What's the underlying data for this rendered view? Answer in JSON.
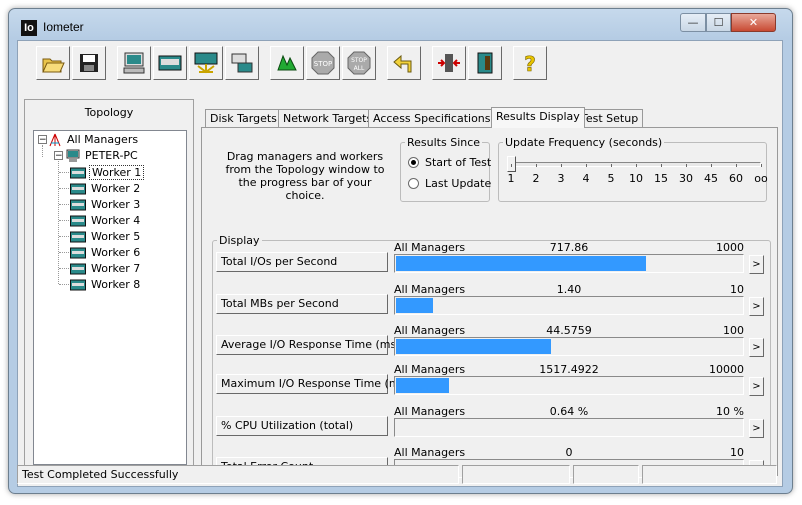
{
  "window": {
    "title": "Iometer",
    "app_icon_text": "Io",
    "controls": {
      "minimize": "—",
      "maximize": "☐",
      "close": "✕"
    }
  },
  "toolbar": {
    "buttons": [
      {
        "name": "open-icon"
      },
      {
        "name": "save-icon"
      },
      {
        "name": "new-manager-icon"
      },
      {
        "name": "new-disk-worker-icon"
      },
      {
        "name": "new-network-worker-icon"
      },
      {
        "name": "duplicate-worker-icon"
      },
      {
        "name": "start-tests-icon"
      },
      {
        "name": "stop-icon",
        "text": "STOP"
      },
      {
        "name": "stop-all-icon",
        "text_top": "STOP",
        "text_bottom": "ALL"
      },
      {
        "name": "reset-workers-icon"
      },
      {
        "name": "exit-icon"
      },
      {
        "name": "exit-program-icon"
      },
      {
        "name": "about-icon",
        "text": "?"
      }
    ]
  },
  "topology": {
    "label": "Topology",
    "root": "All Managers",
    "manager": "PETER-PC",
    "workers": [
      "Worker 1",
      "Worker 2",
      "Worker 3",
      "Worker 4",
      "Worker 5",
      "Worker 6",
      "Worker 7",
      "Worker 8"
    ],
    "selected_worker": "Worker 1",
    "expand_symbols": {
      "root": "−",
      "manager": "−"
    }
  },
  "tabs": [
    "Disk Targets",
    "Network Targets",
    "Access Specifications",
    "Results Display",
    "Test Setup"
  ],
  "active_tab": "Results Display",
  "results": {
    "instructions": "Drag managers and workers from the Topology window to the progress bar of your choice.",
    "results_since": {
      "legend": "Results Since",
      "options": [
        "Start of Test",
        "Last Update"
      ],
      "selected": "Start of Test"
    },
    "update_frequency": {
      "legend": "Update Frequency (seconds)",
      "ticks": [
        "1",
        "2",
        "3",
        "4",
        "5",
        "10",
        "15",
        "30",
        "45",
        "60",
        "oo"
      ],
      "selected": "1"
    },
    "display_legend": "Display",
    "arrow_label": ">",
    "rows": [
      {
        "label": "Total I/Os per Second",
        "source": "All Managers",
        "value": "717.86",
        "max": "1000",
        "fraction": 0.718
      },
      {
        "label": "Total MBs per Second",
        "source": "All Managers",
        "value": "1.40",
        "max": "10",
        "fraction": 0.105
      },
      {
        "label": "Average I/O Response Time (ms)",
        "source": "All Managers",
        "value": "44.5759",
        "max": "100",
        "fraction": 0.446
      },
      {
        "label": "Maximum I/O Response Time (ms)",
        "source": "All Managers",
        "value": "1517.4922",
        "max": "10000",
        "fraction": 0.152
      },
      {
        "label": "% CPU Utilization (total)",
        "source": "All Managers",
        "value": "0.64 %",
        "max": "10 %",
        "fraction": 0.0
      },
      {
        "label": "Total Error Count",
        "source": "All Managers",
        "value": "0",
        "max": "10",
        "fraction": 0.0
      }
    ]
  },
  "status_bar": {
    "message": "Test Completed Successfully"
  },
  "colors": {
    "bar_fill": "#3399ff",
    "window_frame": "#b5cce4",
    "close_button": "#c84a33"
  }
}
